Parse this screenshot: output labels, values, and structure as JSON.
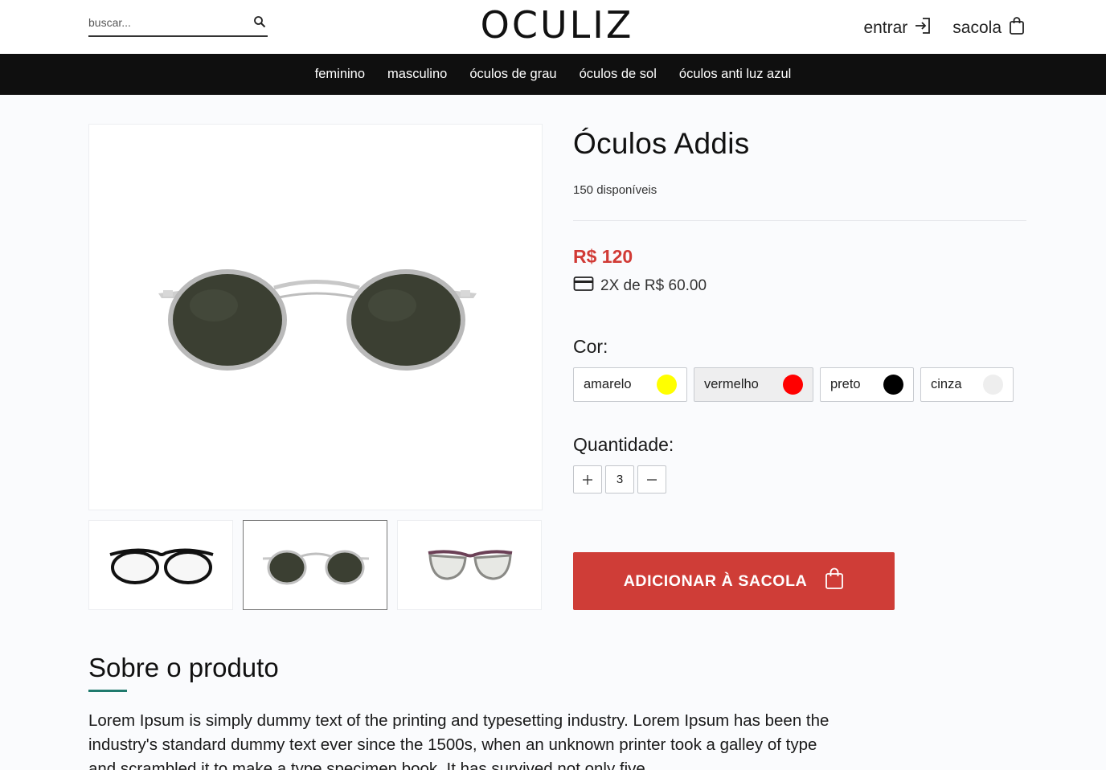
{
  "header": {
    "search_placeholder": "buscar...",
    "logo": "OCULIZ",
    "login_label": "entrar",
    "bag_label": "sacola"
  },
  "nav": {
    "items": [
      "feminino",
      "masculino",
      "óculos de grau",
      "óculos de sol",
      "óculos anti luz azul"
    ]
  },
  "gallery": {
    "thumbnails": [
      {
        "icon": "clear-glasses-black-frame",
        "selected": false
      },
      {
        "icon": "sunglasses-silver-frame",
        "selected": true
      },
      {
        "icon": "clear-glasses-purple-frame",
        "selected": false
      }
    ]
  },
  "product": {
    "title": "Óculos Addis",
    "stock": "150 disponíveis",
    "price": "R$ 120",
    "installments": "2X de R$ 60.00",
    "color_label": "Cor:",
    "colors": [
      {
        "name": "amarelo",
        "hex": "#ffff00",
        "selected": false
      },
      {
        "name": "vermelho",
        "hex": "#ff0000",
        "selected": true
      },
      {
        "name": "preto",
        "hex": "#000000",
        "selected": false
      },
      {
        "name": "cinza",
        "hex": "#eeeeee",
        "selected": false
      }
    ],
    "quantity_label": "Quantidade:",
    "quantity": "3",
    "add_to_bag_label": "ADICIONAR À SACOLA"
  },
  "about": {
    "title": "Sobre o produto",
    "text": "Lorem Ipsum is simply dummy text of the printing and typesetting industry. Lorem Ipsum has been the industry's standard dummy text ever since the 1500s, when an unknown printer took a galley of type and scrambled it to make a type specimen book. It has survived not only five"
  },
  "colors": {
    "accent_red": "#cf3d37",
    "nav_bg": "#0f0f0f",
    "underline_teal": "#1f7a6d"
  }
}
